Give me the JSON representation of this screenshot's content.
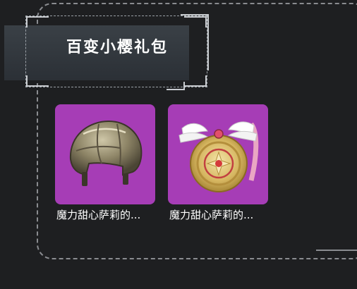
{
  "header": {
    "title": "百变小樱礼包"
  },
  "items": [
    {
      "label": "魔力甜心萨莉的...",
      "icon": "helmet-icon",
      "rarity_color": "#a63db6"
    },
    {
      "label": "魔力甜心萨莉的...",
      "icon": "winged-backpack-icon",
      "rarity_color": "#a63db6"
    }
  ],
  "colors": {
    "background": "#1e1f21",
    "card_purple": "#a63db6",
    "dashed_border": "#8a8c90"
  }
}
